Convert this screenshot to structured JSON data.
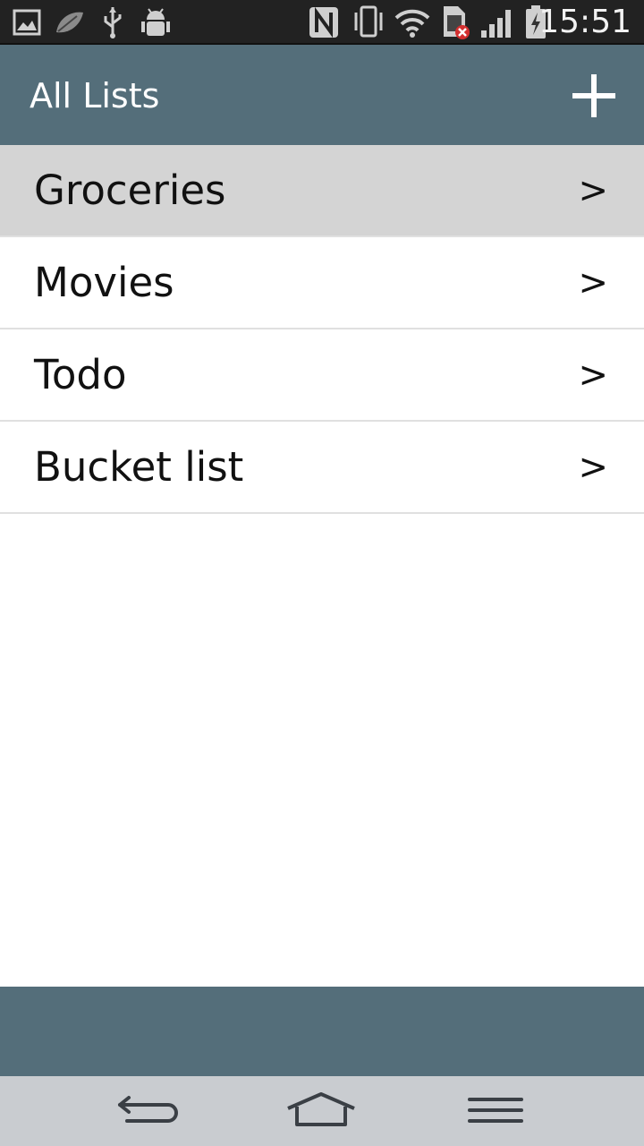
{
  "status_bar": {
    "time": "15:51",
    "icons": [
      "gallery-icon",
      "leaf-icon",
      "usb-icon",
      "android-debug-icon",
      "nfc-icon",
      "vibrate-icon",
      "wifi-icon",
      "sim-error-icon",
      "signal-icon",
      "battery-charging-icon"
    ]
  },
  "app_bar": {
    "title": "All Lists",
    "add_icon": "plus-icon",
    "color": "#546e7a"
  },
  "lists": [
    {
      "label": "Groceries",
      "chevron": ">",
      "selected": true
    },
    {
      "label": "Movies",
      "chevron": ">",
      "selected": false
    },
    {
      "label": "Todo",
      "chevron": ">",
      "selected": false
    },
    {
      "label": "Bucket list",
      "chevron": ">",
      "selected": false
    }
  ],
  "nav_bar": {
    "icons": [
      "back-icon",
      "home-icon",
      "menu-icon"
    ]
  }
}
